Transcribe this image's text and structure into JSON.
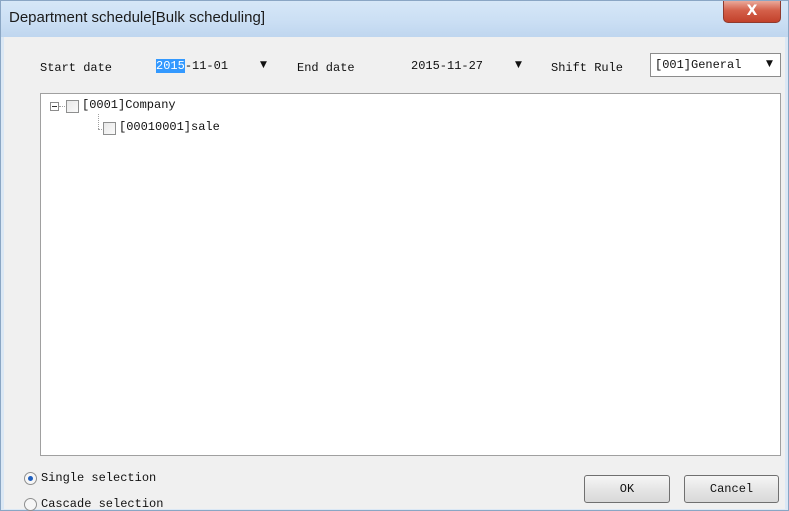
{
  "window": {
    "title": "Department schedule[Bulk scheduling]",
    "close_glyph": "X"
  },
  "filters": {
    "start_date_label": "Start date",
    "start_date_selected": "2015",
    "start_date_rest": "-11-01",
    "end_date_label": "End date",
    "end_date_value": "2015-11-27",
    "shift_rule_label": "Shift Rule",
    "shift_rule_value": "[001]General",
    "arrow_glyph": "▼"
  },
  "tree": {
    "nodes": [
      {
        "label": "[0001]Company",
        "level": 0,
        "expanded": true,
        "checked": false
      },
      {
        "label": "[00010001]sale",
        "level": 1,
        "checked": false
      }
    ]
  },
  "selection_mode": {
    "single_label": "Single selection",
    "cascade_label": "Cascade selection",
    "selected": "single"
  },
  "buttons": {
    "ok_label": "OK",
    "cancel_label": "Cancel"
  },
  "icons": {
    "close": "close-icon",
    "dropdown": "chevron-down-icon",
    "tree_toggle": "minus-box-icon"
  }
}
